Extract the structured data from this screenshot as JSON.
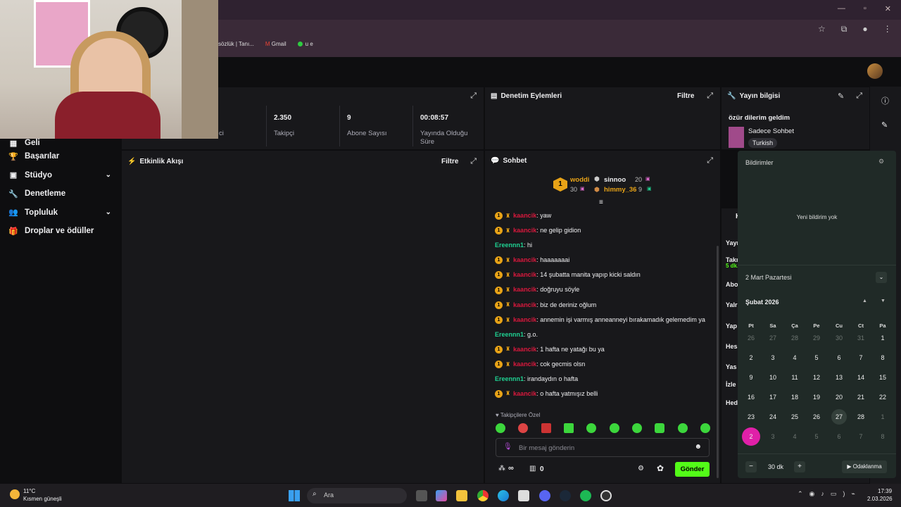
{
  "browser": {
    "bookmarks": [
      "sözlük | Tanı...",
      "Gmail",
      "u e"
    ]
  },
  "sidebar": {
    "items": [
      {
        "label": "Geli",
        "icon": "calendar-icon"
      },
      {
        "label": "Başarılar",
        "icon": "trophy-icon"
      },
      {
        "label": "Stüdyo",
        "icon": "studio-icon",
        "expandable": true
      },
      {
        "label": "Denetleme",
        "icon": "wrench-icon"
      },
      {
        "label": "Topluluk",
        "icon": "people-icon",
        "expandable": true
      },
      {
        "label": "Droplar ve ödüller",
        "icon": "gift-icon"
      }
    ]
  },
  "stats": {
    "partial_label": "ci",
    "followers": {
      "value": "2.350",
      "label": "Takipçi"
    },
    "subs": {
      "value": "9",
      "label": "Abone Sayısı"
    },
    "uptime": {
      "value": "00:08:57",
      "label": "Yayında Olduğu Süre"
    }
  },
  "mod_panel": {
    "title": "Denetim Eylemleri",
    "filter": "Filtre"
  },
  "activity_panel": {
    "title": "Etkinlik Akışı",
    "filter": "Filtre"
  },
  "stream_info": {
    "title": "Yayın bilgisi",
    "stream_title": "özür dilerim geldim",
    "category": "Sadece Sohbet",
    "language": "Turkish"
  },
  "chat": {
    "title": "Sohbet",
    "leaderboard": [
      {
        "rank": "1",
        "name": "woddi",
        "count": "30"
      },
      {
        "name": "sinnoo",
        "count": "20"
      },
      {
        "name": "himmy_36",
        "count": "9"
      }
    ],
    "messages": [
      {
        "user": "kaancik",
        "color": "red",
        "sub": true,
        "text": ": yaw"
      },
      {
        "user": "kaancik",
        "color": "red",
        "sub": true,
        "text": ": ne gelip gidion"
      },
      {
        "user": "Ereennn1",
        "color": "green",
        "sub": false,
        "text": ": hi"
      },
      {
        "user": "kaancik",
        "color": "red",
        "sub": true,
        "text": ": haaaaaaai"
      },
      {
        "user": "kaancik",
        "color": "red",
        "sub": true,
        "text": ": 14 şubatta manita yapıp kicki saldın"
      },
      {
        "user": "kaancik",
        "color": "red",
        "sub": true,
        "text": ": doğruyu söyle"
      },
      {
        "user": "kaancik",
        "color": "red",
        "sub": true,
        "text": ": biz de deriniz oğlum"
      },
      {
        "user": "kaancik",
        "color": "red",
        "sub": true,
        "text": ": annemin işi varmış anneanneyi bırakamadık gelemedim ya"
      },
      {
        "user": "Ereennn1",
        "color": "green",
        "sub": false,
        "text": ": g.o."
      },
      {
        "user": "kaancik",
        "color": "red",
        "sub": true,
        "text": ": 1 hafta ne yatağı bu ya"
      },
      {
        "user": "kaancik",
        "color": "red",
        "sub": true,
        "text": ": cok gecmis olsn"
      },
      {
        "user": "Ereennn1",
        "color": "green",
        "sub": false,
        "text": ": irandaydın o hafta"
      },
      {
        "user": "kaancik",
        "color": "red",
        "sub": true,
        "text": ": o hafta yatmışız belli"
      }
    ],
    "followers_only": "Takipçilere Özel",
    "input_placeholder": "Bir mesaj gönderin",
    "points": "∞",
    "store_count": "0",
    "send_label": "Gönder"
  },
  "right_col": {
    "partial_header": "K",
    "labels": [
      "Yayı",
      "Takı",
      "Abo",
      "Yalr",
      "Yap",
      "Hes",
      "Yas",
      "İzle",
      "Hed"
    ],
    "partial_green": "5 dk."
  },
  "notifications": {
    "title": "Bildirimler",
    "empty": "Yeni bildirim yok",
    "date_select": "2 Mart Pazartesi",
    "month": "Şubat 2026",
    "dow": [
      "Pt",
      "Sa",
      "Ça",
      "Pe",
      "Cu",
      "Ct",
      "Pa"
    ],
    "weeks": [
      [
        "26",
        "27",
        "28",
        "29",
        "30",
        "31",
        "1"
      ],
      [
        "2",
        "3",
        "4",
        "5",
        "6",
        "7",
        "8"
      ],
      [
        "9",
        "10",
        "11",
        "12",
        "13",
        "14",
        "15"
      ],
      [
        "16",
        "17",
        "18",
        "19",
        "20",
        "21",
        "22"
      ],
      [
        "23",
        "24",
        "25",
        "26",
        "27",
        "28",
        "1"
      ],
      [
        "2",
        "3",
        "4",
        "5",
        "6",
        "7",
        "8"
      ]
    ],
    "focus_minutes": "30 dk",
    "focus_label": "Odaklanma"
  },
  "taskbar": {
    "temp": "11°C",
    "weather": "Kısmen güneşli",
    "search": "Ara",
    "time": "17:39",
    "date": "2.03.2026"
  },
  "colors": {
    "accent": "#53fc18",
    "highlight": "#e020a8",
    "sub_badge": "#e8a317"
  }
}
